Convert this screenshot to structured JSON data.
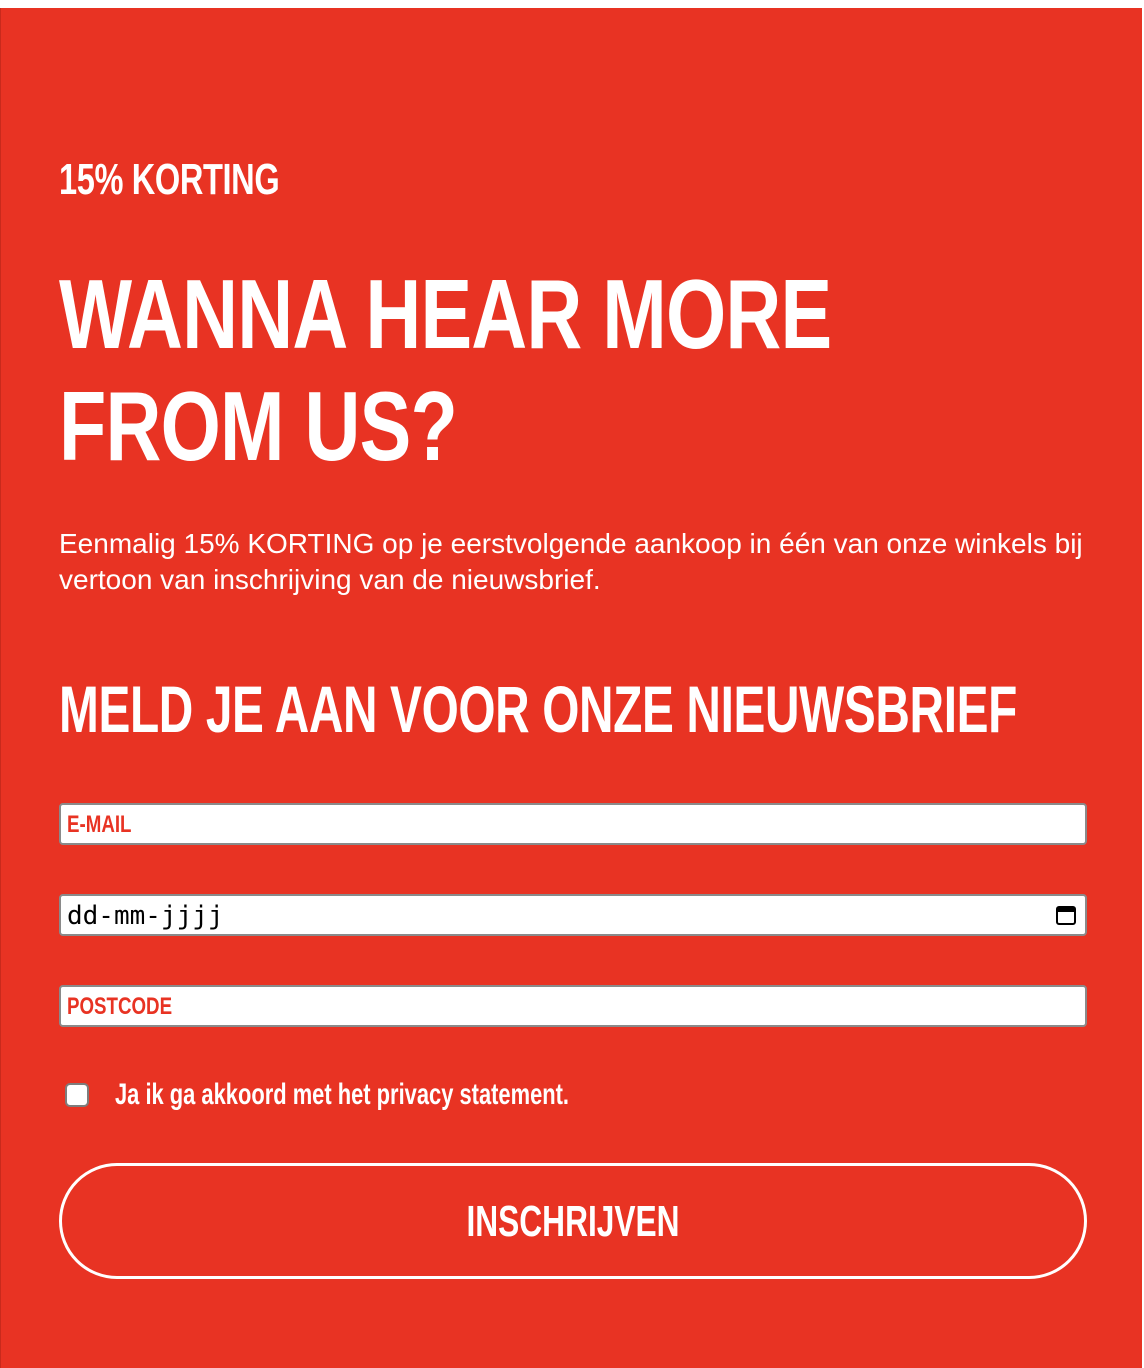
{
  "form": {
    "kicker": "15% KORTING",
    "headline": "WANNA HEAR MORE FROM US?",
    "intro": "Eenmalig 15% KORTING op je eerstvolgende aankoop in één van onze winkels bij vertoon van inschrijving van de nieuwsbrief.",
    "subhead": "MELD JE AAN VOOR ONZE NIEUWSBRIEF",
    "email": {
      "placeholder": "E-MAIL",
      "value": ""
    },
    "birthdate": {
      "placeholder": "dd-mm-jjjj",
      "value": ""
    },
    "postcode": {
      "placeholder": "POSTCODE",
      "value": ""
    },
    "consent": {
      "label": "Ja ik ga akkoord met het privacy statement.",
      "checked": false
    },
    "submit_label": "INSCHRIJVEN"
  },
  "colors": {
    "background": "#e83323",
    "text": "#ffffff",
    "field_background": "#ffffff",
    "placeholder": "#e83323"
  },
  "icons": {
    "date_picker": "calendar-icon"
  }
}
